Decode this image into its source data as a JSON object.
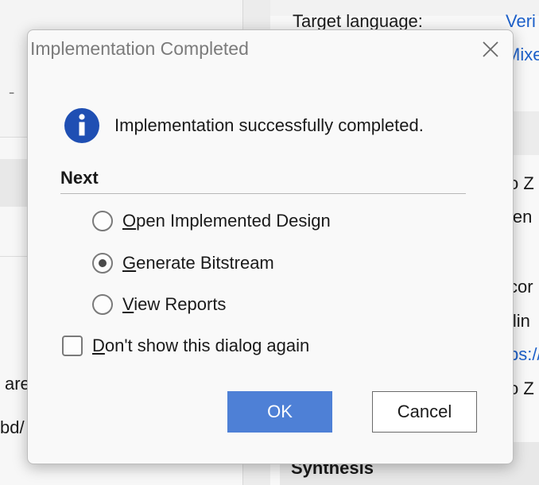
{
  "background": {
    "left_fragments": [
      "are",
      "bd/"
    ],
    "dashes": "- - -",
    "target_language_label": "Target language:",
    "right_links": [
      "Veri",
      "Mixe",
      "ps://"
    ],
    "right_fragments": [
      "o Z",
      "len",
      "cor",
      "ilin",
      "o Z"
    ],
    "section_heading": "Synthesis"
  },
  "dialog": {
    "title": "Implementation Completed",
    "message": "Implementation successfully completed.",
    "section_title": "Next",
    "options": [
      {
        "label": "Open Implemented Design",
        "mnemonic": "O",
        "rest": "pen Implemented Design",
        "checked": false
      },
      {
        "label": "Generate Bitstream",
        "mnemonic": "G",
        "rest": "enerate Bitstream",
        "checked": true
      },
      {
        "label": "View Reports",
        "mnemonic": "V",
        "rest": "iew Reports",
        "checked": false
      }
    ],
    "dont_show": {
      "label": "Don't show this dialog again",
      "mnemonic": "D",
      "rest": "on't show this dialog again",
      "checked": false
    },
    "ok_label": "OK",
    "cancel_label": "Cancel"
  },
  "colors": {
    "accent": "#4e80d6",
    "info_icon": "#1f4fb3",
    "link": "#1d60c9"
  },
  "icons": {
    "close": "close-icon",
    "info": "info-icon"
  }
}
